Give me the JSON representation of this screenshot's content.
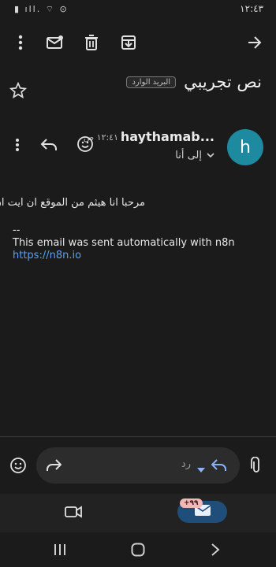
{
  "status": {
    "time": "١٢:٤٣",
    "icons": "▮ ıll. ⌔ ⊙"
  },
  "toolbar": {
    "more": "more-vert-icon",
    "mark_unread": "mark-unread-icon",
    "delete": "delete-icon",
    "archive": "archive-icon",
    "forward": "arrow-forward-icon"
  },
  "email": {
    "subject": "نص تجريبي",
    "label": "البريد الوارد",
    "sender": "haythamab...",
    "avatar_letter": "h",
    "time": "١٢:٤١ ص",
    "to": "إلى أنا",
    "body_ar": "مرحبا انا هيثم من الموقع ان ايت ان",
    "sig_sep": "--",
    "sig_line": "This email was sent automatically with n8n",
    "link": "https://n8n.io"
  },
  "reply": {
    "placeholder": "رد"
  },
  "bottom": {
    "badge": "+٩٩"
  },
  "colors": {
    "avatar": "#1e8aa0",
    "link": "#5aa0f0",
    "pill": "#1f4e7a"
  }
}
